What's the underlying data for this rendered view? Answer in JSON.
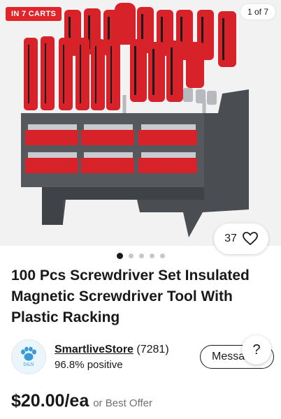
{
  "badge": {
    "text": "IN 7 CARTS",
    "color": "#e0252a"
  },
  "image_counter": "1 of 7",
  "image_alt_icon": "screwdriver-set-photo",
  "watch": {
    "count": "37",
    "icon": "heart-outline-icon"
  },
  "carousel": {
    "total": 5,
    "active_index": 0
  },
  "title": "100 Pcs Screwdriver Set Insulated Magnetic Screwdriver Tool With Plastic Racking",
  "seller": {
    "name": "SmartliveStore",
    "feedback_count": "(7281)",
    "positive": "96.8% positive",
    "avatar_icon": "paw-icon",
    "avatar_tag": "D&N"
  },
  "message_button": "Messa",
  "help_label": "?",
  "price": {
    "amount": "$20.00/ea",
    "best_offer": "or Best Offer"
  },
  "colors": {
    "product_red": "#d8222a",
    "rack_gray": "#4a4d52",
    "text": "#191919"
  }
}
